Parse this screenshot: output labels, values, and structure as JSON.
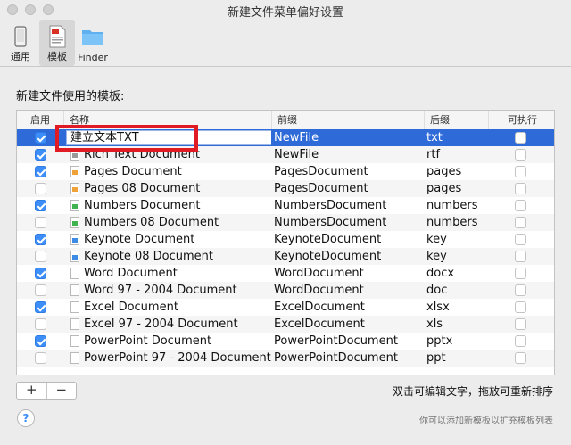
{
  "window": {
    "title": "新建文件菜单偏好设置"
  },
  "toolbar": {
    "items": [
      {
        "label": "通用",
        "icon": "phone-icon"
      },
      {
        "label": "模板",
        "icon": "file-template-icon"
      },
      {
        "label": "Finder",
        "icon": "folder-icon"
      }
    ]
  },
  "section": {
    "label": "新建文件使用的模板:"
  },
  "table": {
    "headers": {
      "enabled": "启用",
      "name": "名称",
      "prefix": "前缀",
      "suffix": "后缀",
      "executable": "可执行"
    },
    "rows": [
      {
        "enabled": true,
        "name": "建立文本TXT",
        "prefix": "NewFile",
        "suffix": "txt",
        "exec": false,
        "editing": true
      },
      {
        "enabled": true,
        "name": "Rich Text Document",
        "prefix": "NewFile",
        "suffix": "rtf",
        "exec": false,
        "icon": "text-doc-icon"
      },
      {
        "enabled": true,
        "name": "Pages Document",
        "prefix": "PagesDocument",
        "suffix": "pages",
        "exec": false,
        "icon": "pages-doc-icon"
      },
      {
        "enabled": false,
        "name": "Pages 08 Document",
        "prefix": "PagesDocument",
        "suffix": "pages",
        "exec": false,
        "icon": "pages-doc-icon"
      },
      {
        "enabled": true,
        "name": "Numbers Document",
        "prefix": "NumbersDocument",
        "suffix": "numbers",
        "exec": false,
        "icon": "numbers-doc-icon"
      },
      {
        "enabled": false,
        "name": "Numbers 08 Document",
        "prefix": "NumbersDocument",
        "suffix": "numbers",
        "exec": false,
        "icon": "numbers-doc-icon"
      },
      {
        "enabled": true,
        "name": "Keynote Document",
        "prefix": "KeynoteDocument",
        "suffix": "key",
        "exec": false,
        "icon": "keynote-doc-icon"
      },
      {
        "enabled": false,
        "name": "Keynote 08 Document",
        "prefix": "KeynoteDocument",
        "suffix": "key",
        "exec": false,
        "icon": "keynote-doc-icon"
      },
      {
        "enabled": true,
        "name": "Word Document",
        "prefix": "WordDocument",
        "suffix": "docx",
        "exec": false,
        "icon": "word-doc-icon"
      },
      {
        "enabled": false,
        "name": "Word 97 - 2004 Document",
        "prefix": "WordDocument",
        "suffix": "doc",
        "exec": false,
        "icon": "word-doc-icon"
      },
      {
        "enabled": true,
        "name": "Excel Document",
        "prefix": "ExcelDocument",
        "suffix": "xlsx",
        "exec": false,
        "icon": "excel-doc-icon"
      },
      {
        "enabled": false,
        "name": "Excel 97 - 2004 Document",
        "prefix": "ExcelDocument",
        "suffix": "xls",
        "exec": false,
        "icon": "excel-doc-icon"
      },
      {
        "enabled": true,
        "name": "PowerPoint Document",
        "prefix": "PowerPointDocument",
        "suffix": "pptx",
        "exec": false,
        "icon": "powerpoint-doc-icon"
      },
      {
        "enabled": false,
        "name": "PowerPoint 97 - 2004 Document",
        "prefix": "PowerPointDocument",
        "suffix": "ppt",
        "exec": false,
        "icon": "powerpoint-doc-icon"
      }
    ]
  },
  "buttons": {
    "add": "+",
    "remove": "−"
  },
  "hint": "双击可编辑文字，拖放可重新排序",
  "subhint": "你可以添加新模板以扩充模板列表",
  "help": "?",
  "colors": {
    "selection": "#2f6bd8",
    "checkbox": "#3d8ef8",
    "highlight": "#e01b24"
  }
}
